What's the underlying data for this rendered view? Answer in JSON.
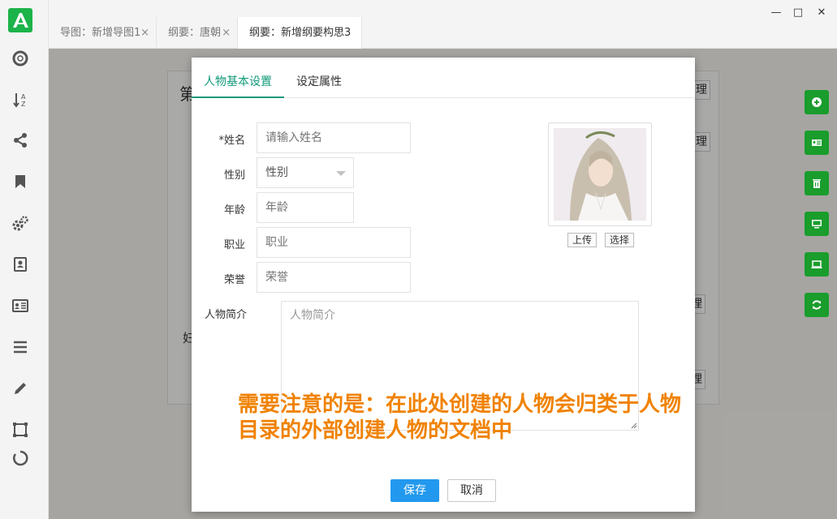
{
  "tabs": [
    {
      "label": "导图：新增导图1"
    },
    {
      "label": "纲要：唐朝"
    },
    {
      "label": "纲要：新增纲要构思3"
    }
  ],
  "tab_close_glyph": "×",
  "window_controls": {
    "minimize": "—",
    "maximize": "□",
    "close": "✕"
  },
  "sidebar_icons": [
    "logo-icon",
    "lifebuoy-icon",
    "sort-az-icon",
    "share-icon",
    "bookmark-icon",
    "gears-icon",
    "contacts-book-icon",
    "id-card-icon",
    "menu-icon",
    "pencil-icon",
    "frame-icon",
    "loading-ring-icon"
  ],
  "background": {
    "heading_partial": "第",
    "buttons_partial": [
      "理",
      "理",
      "理",
      "理"
    ],
    "text_partial": "妇"
  },
  "right_toolbar_icons": [
    "plus-circle-icon",
    "id-badge-icon",
    "trash-icon",
    "monitor-icon",
    "laptop-icon",
    "refresh-icon"
  ],
  "dialog": {
    "tabs": [
      {
        "label": "人物基本设置",
        "active": true
      },
      {
        "label": "设定属性",
        "active": false
      }
    ],
    "fields": {
      "name": {
        "label": "*姓名",
        "placeholder": "请输入姓名"
      },
      "gender": {
        "label": "性别",
        "value": "性别"
      },
      "age": {
        "label": "年龄",
        "placeholder": "年龄"
      },
      "job": {
        "label": "职业",
        "placeholder": "职业"
      },
      "honor": {
        "label": "荣誉",
        "placeholder": "荣誉"
      },
      "intro": {
        "label": "人物简介",
        "placeholder": "人物简介"
      }
    },
    "avatar_buttons": {
      "upload": "上传",
      "select": "选择"
    },
    "annotation": "需要注意的是：在此处创建的人物会归类于人物目录的外部创建人物的文档中",
    "save": "保存",
    "cancel": "取消"
  },
  "colors": {
    "accent_green": "#1a9d2c",
    "tab_teal": "#119a7a",
    "primary_blue": "#2299ee",
    "annotation_orange": "#f08200"
  }
}
